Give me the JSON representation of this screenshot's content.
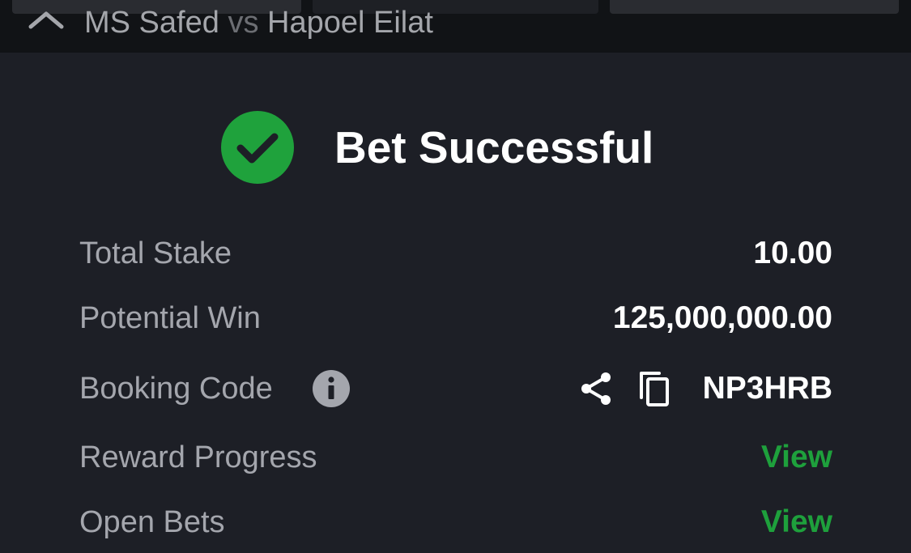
{
  "header": {
    "home_team": "MS Safed",
    "vs": "vs",
    "away_team": "Hapoel Eilat"
  },
  "success": {
    "title": "Bet Successful",
    "accent_color": "#1fa23c"
  },
  "details": {
    "total_stake": {
      "label": "Total Stake",
      "value": "10.00"
    },
    "potential_win": {
      "label": "Potential Win",
      "value": "125,000,000.00"
    },
    "booking_code": {
      "label": "Booking Code",
      "value": "NP3HRB",
      "info_icon": "info-icon",
      "share_icon": "share-icon",
      "copy_icon": "copy-icon"
    },
    "reward_progress": {
      "label": "Reward Progress",
      "link": "View"
    },
    "open_bets": {
      "label": "Open Bets",
      "link": "View"
    }
  },
  "colors": {
    "background": "#1d1f26",
    "header_bg": "#111316",
    "label": "#a4a6ad",
    "value": "#ffffff",
    "link": "#1ea03c"
  }
}
